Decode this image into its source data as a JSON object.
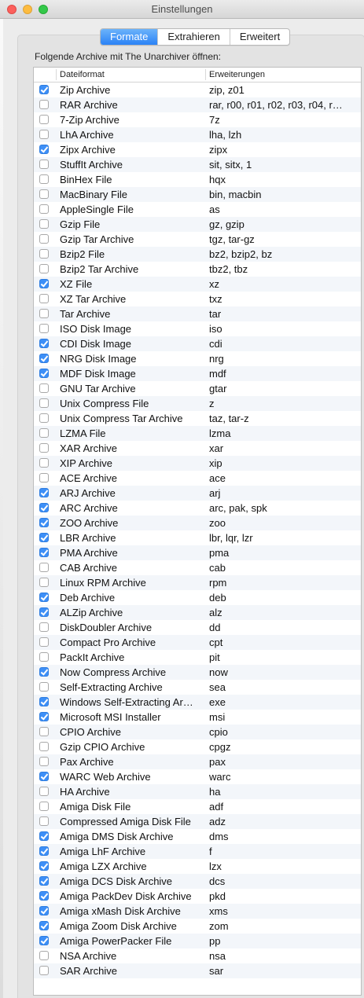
{
  "window": {
    "title": "Einstellungen"
  },
  "tabs": [
    {
      "label": "Formate",
      "active": true
    },
    {
      "label": "Extrahieren",
      "active": false
    },
    {
      "label": "Erweitert",
      "active": false
    }
  ],
  "heading": "Folgende Archive mit The Unarchiver öffnen:",
  "table": {
    "columns": [
      "Dateiformat",
      "Erweiterungen"
    ],
    "rows": [
      {
        "checked": true,
        "format": "Zip Archive",
        "ext": "zip, z01"
      },
      {
        "checked": false,
        "format": "RAR Archive",
        "ext": "rar, r00, r01, r02, r03, r04, r…"
      },
      {
        "checked": false,
        "format": "7-Zip Archive",
        "ext": "7z"
      },
      {
        "checked": false,
        "format": "LhA Archive",
        "ext": "lha, lzh"
      },
      {
        "checked": true,
        "format": "Zipx Archive",
        "ext": "zipx"
      },
      {
        "checked": false,
        "format": "StuffIt Archive",
        "ext": "sit, sitx, 1"
      },
      {
        "checked": false,
        "format": "BinHex File",
        "ext": "hqx"
      },
      {
        "checked": false,
        "format": "MacBinary File",
        "ext": "bin, macbin"
      },
      {
        "checked": false,
        "format": "AppleSingle File",
        "ext": "as"
      },
      {
        "checked": false,
        "format": "Gzip File",
        "ext": "gz, gzip"
      },
      {
        "checked": false,
        "format": "Gzip Tar Archive",
        "ext": "tgz, tar-gz"
      },
      {
        "checked": false,
        "format": "Bzip2 File",
        "ext": "bz2, bzip2, bz"
      },
      {
        "checked": false,
        "format": "Bzip2 Tar Archive",
        "ext": "tbz2, tbz"
      },
      {
        "checked": true,
        "format": "XZ File",
        "ext": "xz"
      },
      {
        "checked": false,
        "format": "XZ Tar Archive",
        "ext": "txz"
      },
      {
        "checked": false,
        "format": "Tar Archive",
        "ext": "tar"
      },
      {
        "checked": false,
        "format": "ISO Disk Image",
        "ext": "iso"
      },
      {
        "checked": true,
        "format": "CDI Disk Image",
        "ext": "cdi"
      },
      {
        "checked": true,
        "format": "NRG Disk Image",
        "ext": "nrg"
      },
      {
        "checked": true,
        "format": "MDF Disk Image",
        "ext": "mdf"
      },
      {
        "checked": false,
        "format": "GNU Tar Archive",
        "ext": "gtar"
      },
      {
        "checked": false,
        "format": "Unix Compress File",
        "ext": "z"
      },
      {
        "checked": false,
        "format": "Unix Compress Tar Archive",
        "ext": "taz, tar-z"
      },
      {
        "checked": false,
        "format": "LZMA File",
        "ext": "lzma"
      },
      {
        "checked": false,
        "format": "XAR Archive",
        "ext": "xar"
      },
      {
        "checked": false,
        "format": "XIP Archive",
        "ext": "xip"
      },
      {
        "checked": false,
        "format": "ACE Archive",
        "ext": "ace"
      },
      {
        "checked": true,
        "format": "ARJ Archive",
        "ext": "arj"
      },
      {
        "checked": true,
        "format": "ARC Archive",
        "ext": "arc, pak, spk"
      },
      {
        "checked": true,
        "format": "ZOO Archive",
        "ext": "zoo"
      },
      {
        "checked": true,
        "format": "LBR Archive",
        "ext": "lbr, lqr, lzr"
      },
      {
        "checked": true,
        "format": "PMA Archive",
        "ext": "pma"
      },
      {
        "checked": false,
        "format": "CAB Archive",
        "ext": "cab"
      },
      {
        "checked": false,
        "format": "Linux RPM Archive",
        "ext": "rpm"
      },
      {
        "checked": true,
        "format": "Deb Archive",
        "ext": "deb"
      },
      {
        "checked": true,
        "format": "ALZip Archive",
        "ext": "alz"
      },
      {
        "checked": false,
        "format": "DiskDoubler Archive",
        "ext": "dd"
      },
      {
        "checked": false,
        "format": "Compact Pro Archive",
        "ext": "cpt"
      },
      {
        "checked": false,
        "format": "PackIt Archive",
        "ext": "pit"
      },
      {
        "checked": true,
        "format": "Now Compress Archive",
        "ext": "now"
      },
      {
        "checked": false,
        "format": "Self-Extracting Archive",
        "ext": "sea"
      },
      {
        "checked": true,
        "format": "Windows Self-Extracting Ar…",
        "ext": "exe"
      },
      {
        "checked": true,
        "format": "Microsoft MSI Installer",
        "ext": "msi"
      },
      {
        "checked": false,
        "format": "CPIO Archive",
        "ext": "cpio"
      },
      {
        "checked": false,
        "format": "Gzip CPIO Archive",
        "ext": "cpgz"
      },
      {
        "checked": false,
        "format": "Pax Archive",
        "ext": "pax"
      },
      {
        "checked": true,
        "format": "WARC Web Archive",
        "ext": "warc"
      },
      {
        "checked": false,
        "format": "HA Archive",
        "ext": "ha"
      },
      {
        "checked": false,
        "format": "Amiga Disk File",
        "ext": "adf"
      },
      {
        "checked": false,
        "format": "Compressed Amiga Disk File",
        "ext": "adz"
      },
      {
        "checked": true,
        "format": "Amiga DMS Disk Archive",
        "ext": "dms"
      },
      {
        "checked": true,
        "format": "Amiga LhF Archive",
        "ext": "f"
      },
      {
        "checked": true,
        "format": "Amiga LZX Archive",
        "ext": "lzx"
      },
      {
        "checked": true,
        "format": "Amiga DCS Disk Archive",
        "ext": "dcs"
      },
      {
        "checked": true,
        "format": "Amiga PackDev Disk Archive",
        "ext": "pkd"
      },
      {
        "checked": true,
        "format": "Amiga xMash Disk Archive",
        "ext": "xms"
      },
      {
        "checked": true,
        "format": "Amiga Zoom Disk Archive",
        "ext": "zom"
      },
      {
        "checked": true,
        "format": "Amiga PowerPacker File",
        "ext": "pp"
      },
      {
        "checked": false,
        "format": "NSA Archive",
        "ext": "nsa"
      },
      {
        "checked": false,
        "format": "SAR Archive",
        "ext": "sar"
      }
    ]
  },
  "colors": {
    "accent": "#3d8ff7",
    "row_alt": "#f3f6fa",
    "window_bg": "#ececec"
  }
}
